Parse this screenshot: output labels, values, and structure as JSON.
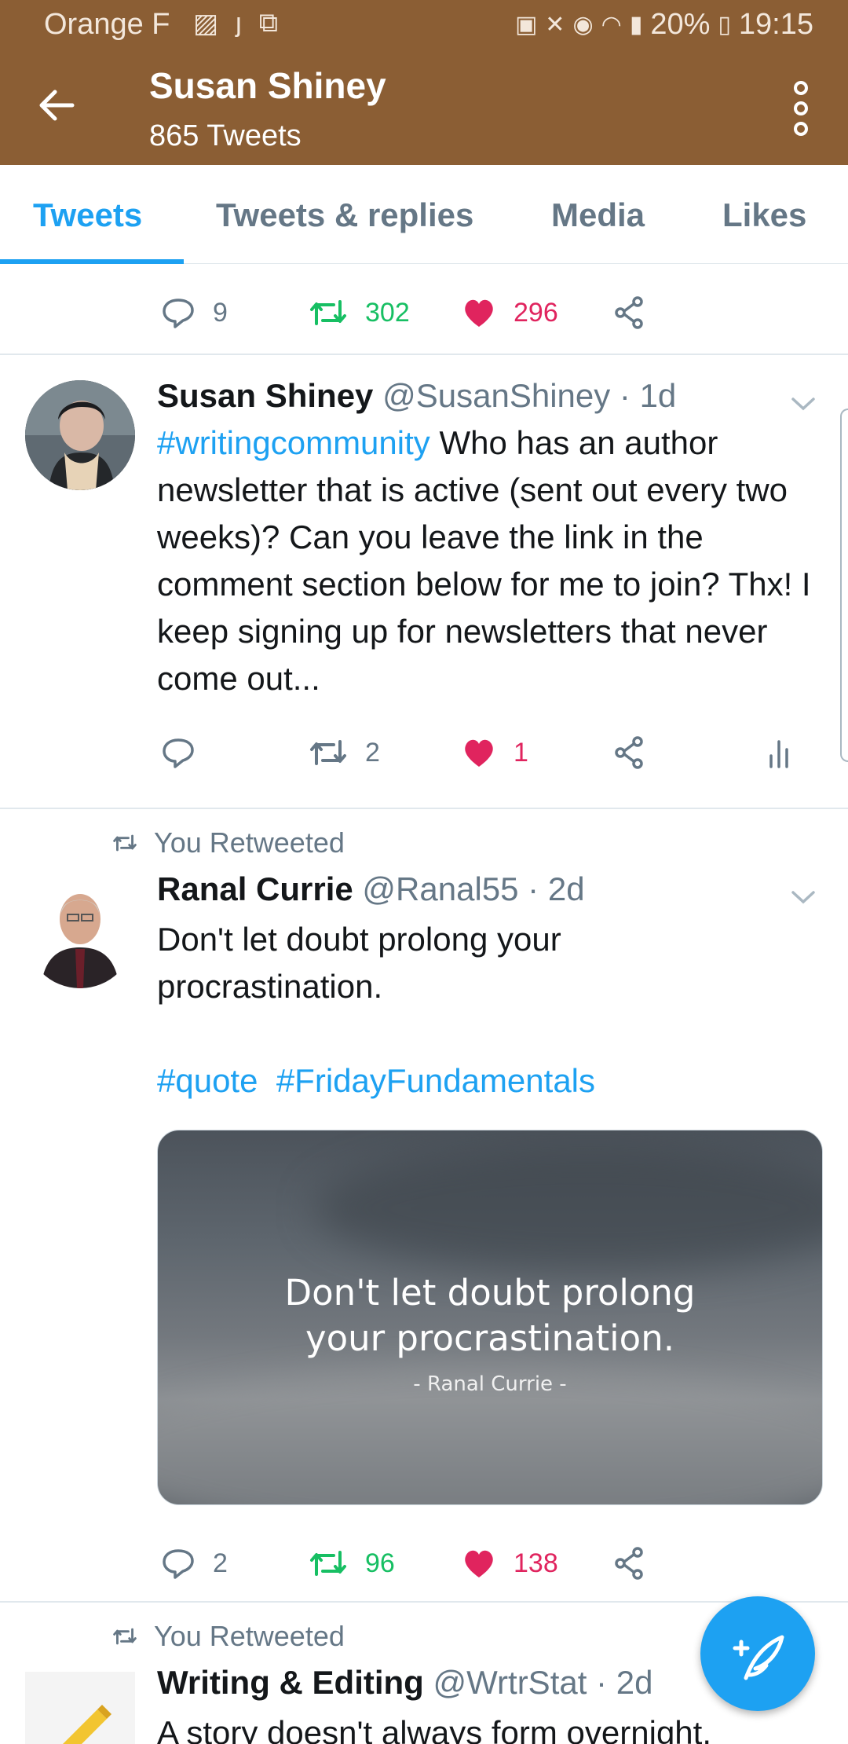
{
  "status_bar": {
    "carrier": "Orange F",
    "battery": "20%",
    "time": "19:15"
  },
  "header": {
    "title": "Susan Shiney",
    "subtitle": "865 Tweets"
  },
  "tabs": [
    "Tweets",
    "Tweets & replies",
    "Media",
    "Likes"
  ],
  "top_actions": {
    "replies": "9",
    "retweets": "302",
    "likes": "296"
  },
  "tweets": [
    {
      "name": "Susan Shiney",
      "handle_time": "@SusanShiney · 1d",
      "hashtag": "#writingcommunity",
      "text": " Who has an author newsletter that is active (sent out every two weeks)? Can you leave the link in the comment section below for me to join? Thx! I keep signing up for newsletters that never come out...",
      "actions": {
        "replies": "",
        "retweets": "2",
        "likes": "1"
      }
    },
    {
      "retweet_label": "You Retweeted",
      "name": "Ranal Currie",
      "handle_time": "@Ranal55 · 2d",
      "text": "Don't let doubt prolong your procrastination.",
      "hashtags": [
        "#quote",
        "#FridayFundamentals"
      ],
      "media_quote_line1": "Don't let doubt prolong",
      "media_quote_line2": "your procrastination.",
      "media_attribution": "- Ranal Currie -",
      "actions": {
        "replies": "2",
        "retweets": "96",
        "likes": "138"
      }
    },
    {
      "retweet_label": "You Retweeted",
      "name": "Writing & Editing",
      "handle_time": "@WrtrStat · 2d",
      "text": "A story doesn't always form overnight."
    }
  ],
  "colors": {
    "header_bg": "#8b5e34",
    "accent": "#1da1f2",
    "retweet": "#17bf63",
    "like": "#e0245e",
    "muted": "#657786"
  }
}
